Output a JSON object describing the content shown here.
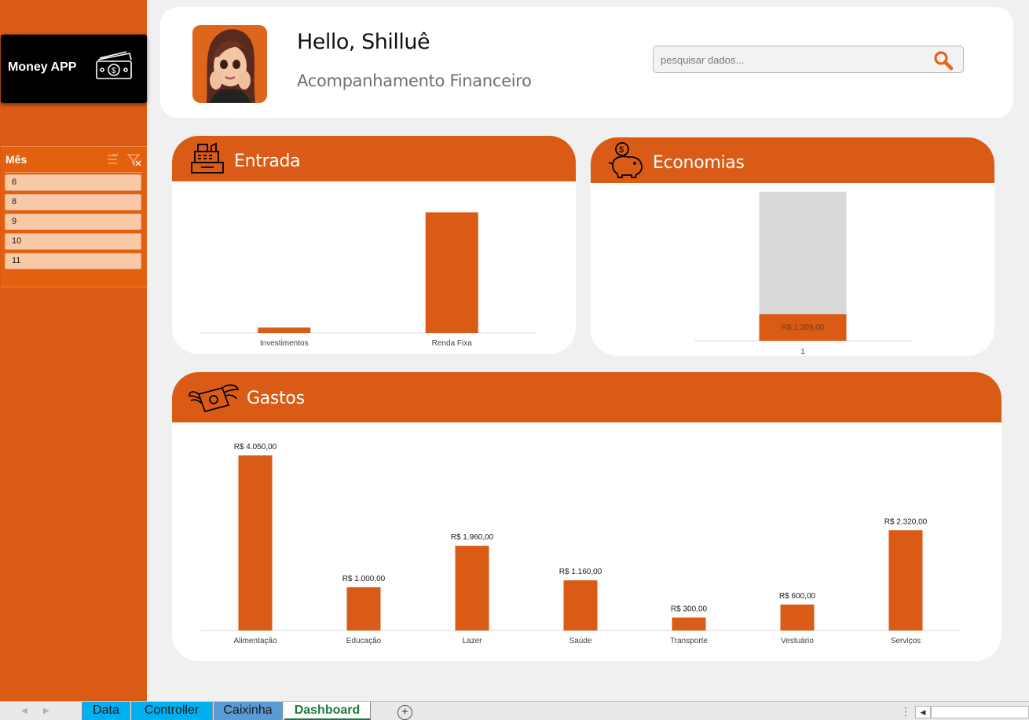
{
  "app": {
    "brand_name": "Money APP",
    "greeting": "Hello, Shilluê",
    "subtitle": "Acompanhamento Financeiro"
  },
  "search": {
    "placeholder": "pesquisar dados...",
    "value": "",
    "icon": "search-icon"
  },
  "slicer": {
    "title": "Mês",
    "items": [
      "6",
      "8",
      "9",
      "10",
      "11"
    ]
  },
  "cards": {
    "entrada": {
      "title": "Entrada",
      "icon": "cash-register-icon"
    },
    "economias": {
      "title": "Economias",
      "icon": "piggy-bank-icon"
    },
    "gastos": {
      "title": "Gastos",
      "icon": "flying-money-icon"
    }
  },
  "colors": {
    "accent": "#d95b15",
    "bar": "#d95b15",
    "bar_background": "#d9d9d9",
    "sheet_active": "#1e7b3a",
    "tab_data": "#00b0f0",
    "tab_controller": "#00b0f0",
    "tab_caixinha": "#5b9bd5"
  },
  "chart_data": [
    {
      "id": "entrada",
      "type": "bar",
      "categories": [
        "Investimentos",
        "Renda Fixa"
      ],
      "values": [
        60,
        1350
      ],
      "ylim": [
        0,
        1600
      ],
      "grid": false,
      "legend": "none"
    },
    {
      "id": "economias",
      "type": "bar",
      "stacked": true,
      "categories": [
        "1"
      ],
      "series": [
        {
          "values": [
            1309
          ]
        },
        {
          "values": [
            6050
          ]
        }
      ],
      "data_labels": [
        "R$ 1.309,00"
      ],
      "ylim": [
        0,
        7400
      ],
      "grid": false,
      "legend": "none"
    },
    {
      "id": "gastos",
      "type": "bar",
      "categories": [
        "Alimentação",
        "Educação",
        "Lazer",
        "Saúde",
        "Transporte",
        "Vestuário",
        "Serviços"
      ],
      "values": [
        4050,
        1000,
        1960,
        1160,
        300,
        600,
        2320
      ],
      "data_labels": [
        "R$ 4.050,00",
        "R$ 1.000,00",
        "R$ 1.960,00",
        "R$ 1.160,00",
        "R$ 300,00",
        "R$ 600,00",
        "R$ 2.320,00"
      ],
      "ylim": [
        0,
        4050
      ],
      "grid": false,
      "legend": "none"
    }
  ],
  "sheet_tabs": [
    {
      "label": "Data",
      "active": false
    },
    {
      "label": "Controller",
      "active": false
    },
    {
      "label": "Caixinha",
      "active": false
    },
    {
      "label": "Dashboard",
      "active": true
    }
  ],
  "add_sheet_label": "+"
}
